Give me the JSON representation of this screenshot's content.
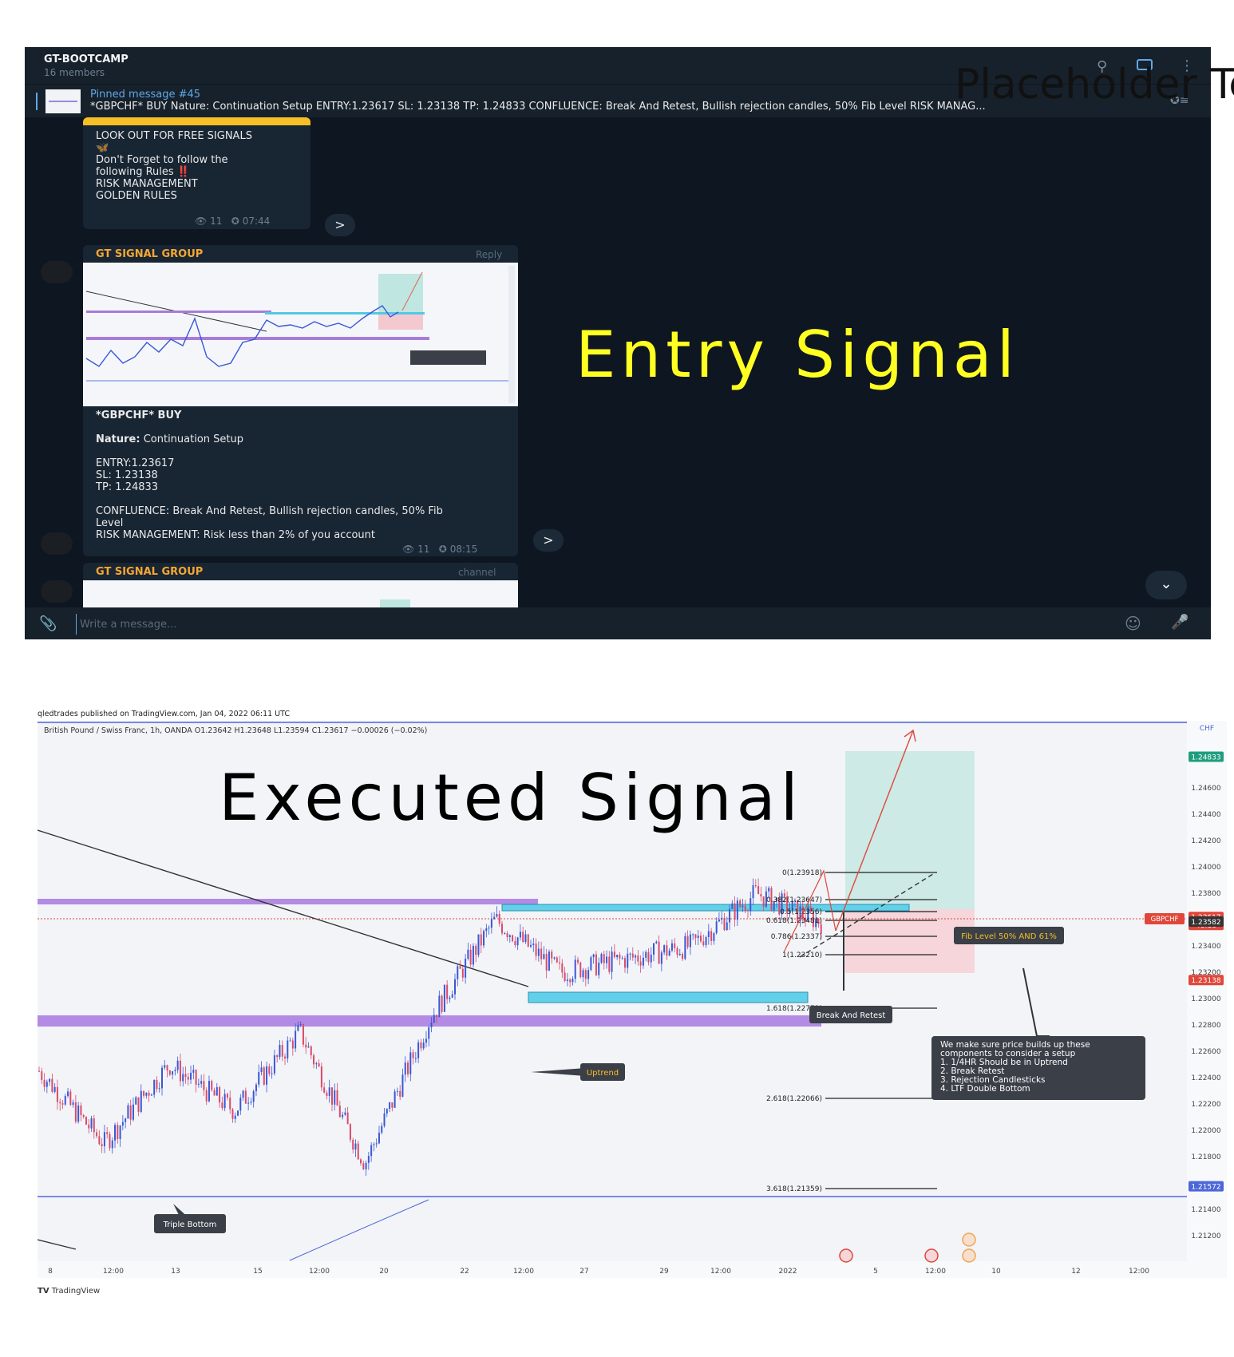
{
  "chat": {
    "title": "GT-BOOTCAMP",
    "members": "16 members",
    "overlay_text": "Placeholder Te",
    "pinned": {
      "title": "Pinned message #45",
      "text": "*GBPCHF* BUY  Nature: Continuation Setup  ENTRY:1.23617 SL: 1.23138 TP: 1.24833  CONFLUENCE: Break And Retest, Bullish rejection candles, 50% Fib Level RISK MANAG..."
    },
    "messages": [
      {
        "lines": [
          "LOOK OUT FOR FREE SIGNALS",
          "",
          "",
          "Don't Forget to follow the",
          "following Rules ‼️",
          "",
          "RISK MANAGEMENT",
          "GOLDEN RULES"
        ],
        "views": "11",
        "time": "07:44"
      },
      {
        "sender": "GT SIGNAL GROUP",
        "tag": "Reply",
        "heading": "*GBPCHF* BUY",
        "nature_label": "Nature:",
        "nature_value": "Continuation Setup",
        "details": "ENTRY:1.23617\nSL: 1.23138\nTP: 1.24833",
        "confluence": "CONFLUENCE: Break And Retest, Bullish rejection candles, 50% Fib\nLevel\nRISK MANAGEMENT: Risk less than 2% of you account",
        "views": "11",
        "time": "08:15"
      },
      {
        "sender": "GT SIGNAL GROUP",
        "tag": "channel"
      }
    ],
    "entry_label": "Entry Signal",
    "composer_placeholder": "Write a message..."
  },
  "tradingview": {
    "attribution": "qledtrades published on TradingView.com, Jan 04, 2022 06:11 UTC",
    "symbol_line": "British Pound / Swiss Franc, 1h, OANDA  O1.23642  H1.23648  L1.23594  C1.23617  −0.00026 (−0.02%)",
    "executed_label": "Executed Signal",
    "brand": "TradingView",
    "currency": "CHF",
    "symbol_tag": "GBPCHF",
    "price_labels": [
      "1.24833",
      "1.24600",
      "1.24400",
      "1.24200",
      "1.24000",
      "1.23800",
      "1.23617",
      "48:18",
      "1.23582",
      "1.23400",
      "1.23200",
      "1.23138",
      "1.23000",
      "1.22800",
      "1.22600",
      "1.22400",
      "1.22200",
      "1.22000",
      "1.21800",
      "1.21572",
      "1.21400",
      "1.21200"
    ],
    "x_labels": [
      "8",
      "12:00",
      "13",
      "15",
      "12:00",
      "20",
      "22",
      "12:00",
      "27",
      "29",
      "12:00",
      "2022",
      "5",
      "12:00",
      "10",
      "12",
      "12:00"
    ],
    "fib_labels": [
      "0(1.23918)",
      "0.382(1.23647)",
      "0.5(1.2356)",
      "0.618(1.23481)",
      "0.786(1.2337)",
      "1(1.23210)",
      "1.618(1.22773)",
      "2.618(1.22066)",
      "3.618(1.21359)"
    ],
    "annotations": {
      "fib_level": "Fib Level 50% AND 61%",
      "break_retest": "Break And Retest",
      "uptrend": "Uptrend",
      "triple_bottom": "Triple Bottom",
      "setup_note": [
        "We make sure price builds up these",
        "components to consider a setup",
        "1. 1/4HR Should be in Uptrend",
        "2. Break Retest",
        "3. Rejection Candlesticks",
        "4. LTF Double Bottom"
      ]
    }
  },
  "chart_data": {
    "type": "line",
    "title": "British Pound / Swiss Franc, 1h, OANDA",
    "x": [
      "8",
      "12:00",
      "13",
      "15",
      "12:00",
      "20",
      "22",
      "12:00",
      "27",
      "29",
      "12:00",
      "2022",
      "5",
      "12:00",
      "10",
      "12",
      "12:00"
    ],
    "ylim": [
      1.211,
      1.249
    ],
    "series": [
      {
        "name": "GBPCHF",
        "approx_close": [
          1.2245,
          1.219,
          1.225,
          1.2215,
          1.2275,
          1.2175,
          1.2285,
          1.236,
          1.232,
          1.233,
          1.234,
          1.238,
          1.2358
        ]
      }
    ],
    "levels": {
      "entry": 1.23617,
      "stop_loss": 1.23138,
      "take_profit": 1.24833,
      "support": 1.21572
    }
  }
}
